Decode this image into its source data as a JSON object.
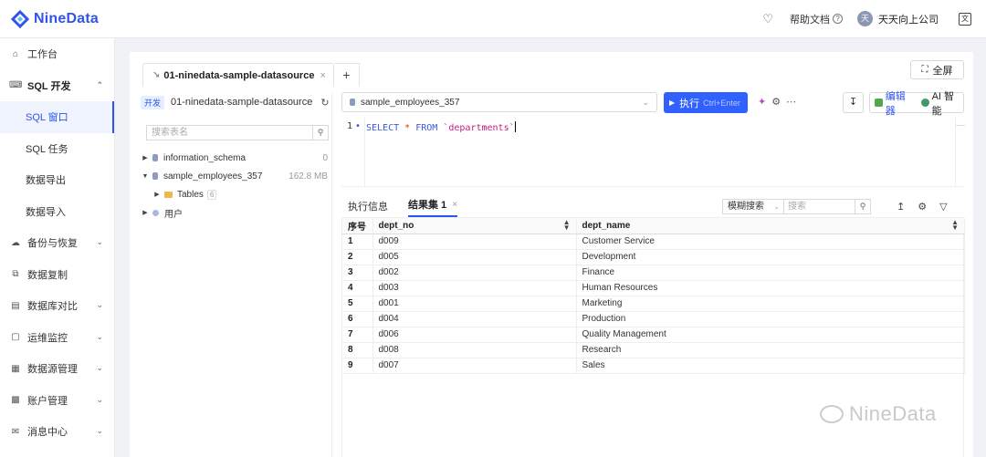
{
  "app": {
    "name": "NineData",
    "help_label": "帮助文档",
    "user_name": "天天向上公司",
    "user_avatar": "天",
    "lang_icon": "language-icon"
  },
  "sidebar": {
    "items": [
      {
        "label": "工作台",
        "icon": "home-icon"
      },
      {
        "label": "SQL 开发",
        "icon": "keyboard-icon"
      },
      {
        "label": "SQL 窗口"
      },
      {
        "label": "SQL 任务"
      },
      {
        "label": "数据导出"
      },
      {
        "label": "数据导入"
      },
      {
        "label": "备份与恢复",
        "icon": "cloud-icon"
      },
      {
        "label": "数据复制",
        "icon": "copy-icon"
      },
      {
        "label": "数据库对比",
        "icon": "compare-icon"
      },
      {
        "label": "运维监控",
        "icon": "monitor-icon"
      },
      {
        "label": "数据源管理",
        "icon": "database-icon"
      },
      {
        "label": "账户管理",
        "icon": "account-icon"
      },
      {
        "label": "消息中心",
        "icon": "mail-icon"
      }
    ]
  },
  "workspace": {
    "tab_label": "01-ninedata-sample-datasource",
    "fullscreen_label": "全屏",
    "env_badge": "开发",
    "datasource_name": "01-ninedata-sample-datasource",
    "tree_search_placeholder": "搜索表名",
    "tree": [
      {
        "label": "information_schema",
        "meta": "0"
      },
      {
        "label": "sample_employees_357",
        "meta": "162.8 MB"
      },
      {
        "label": "Tables",
        "count": "6"
      },
      {
        "label": "用户"
      }
    ]
  },
  "editor": {
    "database": "sample_employees_357",
    "run_label": "执行",
    "run_shortcut": "Ctrl+Enter",
    "mode_editor": "编辑器",
    "mode_ai": "AI 智能",
    "line_number": "1",
    "code_select": "SELECT",
    "code_star": "*",
    "code_from": "FROM",
    "code_table": "`departments`"
  },
  "result": {
    "tab_info": "执行信息",
    "tab_result": "结果集 1",
    "filter_label": "模糊搜索",
    "search_placeholder": "搜索",
    "columns": [
      "序号",
      "dept_no",
      "dept_name"
    ],
    "rows": [
      [
        "1",
        "d009",
        "Customer Service"
      ],
      [
        "2",
        "d005",
        "Development"
      ],
      [
        "3",
        "d002",
        "Finance"
      ],
      [
        "4",
        "d003",
        "Human Resources"
      ],
      [
        "5",
        "d001",
        "Marketing"
      ],
      [
        "6",
        "d004",
        "Production"
      ],
      [
        "7",
        "d006",
        "Quality Management"
      ],
      [
        "8",
        "d008",
        "Research"
      ],
      [
        "9",
        "d007",
        "Sales"
      ]
    ]
  },
  "watermark": "NineData",
  "colors": {
    "accent": "#2f54eb",
    "run_button": "#3061ff"
  }
}
